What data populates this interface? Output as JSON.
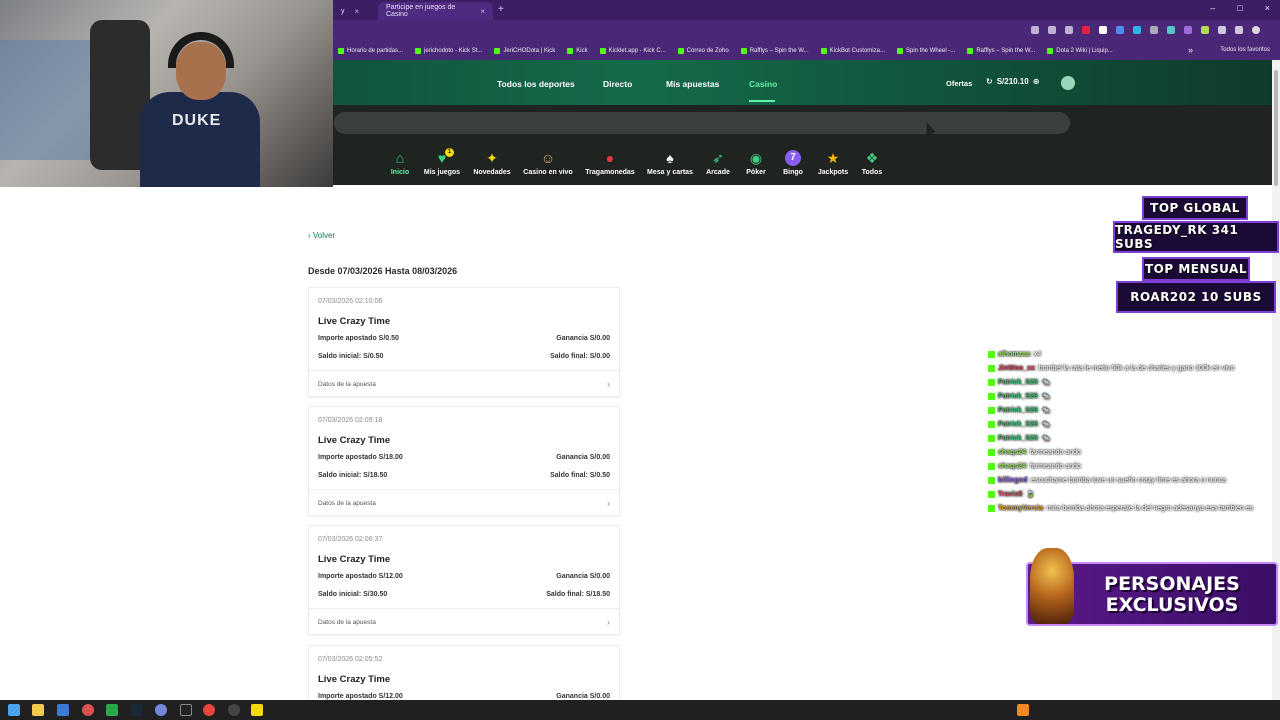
{
  "browser": {
    "tabs": [
      {
        "label": "y",
        "active": false
      },
      {
        "label": "Participe en juegos de Casino",
        "active": true
      }
    ],
    "bookmarks": [
      "Horario de partidas...",
      "jerichodoto - Kick St...",
      "JeriCHODota | Kick",
      "Kick",
      "Kicklet.app - Kick C...",
      "Correo de Zoho",
      "Rafflys – Spin the W...",
      "KickBot Customiza...",
      "Spin the Wheel -...",
      "Rafflys – Spin the W...",
      "Dota 2 Wiki | Liquip..."
    ],
    "bookmarks_more": "»",
    "all_bookmarks": "Todos los favoritos"
  },
  "site": {
    "nav": [
      "Todos los deportes",
      "Directo",
      "Mis apuestas",
      "Casino"
    ],
    "ofertas": "Ofertas",
    "balance": "S/210.10",
    "categories": [
      {
        "label": "Inicio",
        "icon": "home-icon",
        "glyph": "⌂"
      },
      {
        "label": "Mis juegos",
        "icon": "heart-icon",
        "glyph": "♥"
      },
      {
        "label": "Novedades",
        "icon": "sparkle-icon",
        "glyph": "✦"
      },
      {
        "label": "Casino en vivo",
        "icon": "dealer-icon",
        "glyph": "☺"
      },
      {
        "label": "Tragamonedas",
        "icon": "cherries-icon",
        "glyph": "●"
      },
      {
        "label": "Mesa y cartas",
        "icon": "cards-icon",
        "glyph": "♠"
      },
      {
        "label": "Arcade",
        "icon": "rocket-icon",
        "glyph": "➶"
      },
      {
        "label": "Póker",
        "icon": "chip-icon",
        "glyph": "◉"
      },
      {
        "label": "Bingo",
        "icon": "bingo-ball-icon",
        "glyph": "7"
      },
      {
        "label": "Jackpots",
        "icon": "star-icon",
        "glyph": "★"
      },
      {
        "label": "Todos",
        "icon": "grid-icon",
        "glyph": "❖"
      }
    ],
    "mis_juegos_badge": "1"
  },
  "content": {
    "volver": "Volver",
    "range": "Desde 07/03/2026 Hasta 08/03/2026",
    "bets": [
      {
        "date": "07/03/2026 02:10:06",
        "game": "Live Crazy Time",
        "importe": "Importe apostado S/0.50",
        "ganancia": "Ganancia S/0.00",
        "saldo_inicial": "Saldo inicial: S/0.50",
        "saldo_final": "Saldo final: S/0.00",
        "details": "Datos de la apuesta"
      },
      {
        "date": "07/03/2026 02:09:18",
        "game": "Live Crazy Time",
        "importe": "Importe apostado S/18.00",
        "ganancia": "Ganancia S/0.00",
        "saldo_inicial": "Saldo inicial: S/18.50",
        "saldo_final": "Saldo final: S/0.50",
        "details": "Datos de la apuesta"
      },
      {
        "date": "07/03/2026 02:06:37",
        "game": "Live Crazy Time",
        "importe": "Importe apostado S/12.00",
        "ganancia": "Ganancia S/0.00",
        "saldo_inicial": "Saldo inicial: S/30.50",
        "saldo_final": "Saldo final: S/18.50",
        "details": "Datos de la apuesta"
      },
      {
        "date": "07/03/2026 02:05:52",
        "game": "Live Crazy Time",
        "importe": "Importe apostado S/12.00",
        "ganancia": "Ganancia S/0.00",
        "saldo_inicial": "",
        "saldo_final": "",
        "details": ""
      }
    ]
  },
  "overlay": {
    "webcam_shirt": "DUKE",
    "top_global": "TOP GLOBAL",
    "top_global_user": "TRAGEDY_RK 341 SUBS",
    "top_mensual": "TOP MENSUAL",
    "top_mensual_user": "ROAR202 10 SUBS",
    "promo": "PERSONAJES EXCLUSIVOS",
    "chat": [
      {
        "user": "alhomzaa",
        "color": "#9be35f",
        "msg": ": x4"
      },
      {
        "user": "JinWoo_xx",
        "color": "#e0405a",
        "msg": ": bombel la rata le metio 50k a la de charles y gano 100k en vivo"
      },
      {
        "user": "Patrick_S26",
        "color": "#3fb86b",
        "msg": ": 🐀"
      },
      {
        "user": "Patrick_S26",
        "color": "#3fb86b",
        "msg": ": 🐀"
      },
      {
        "user": "Patrick_S26",
        "color": "#3fb86b",
        "msg": ": 🐀"
      },
      {
        "user": "Patrick_S26",
        "color": "#3fb86b",
        "msg": ": 🐀"
      },
      {
        "user": "Patrick_S26",
        "color": "#3fb86b",
        "msg": ": 🐀"
      },
      {
        "user": "shaqs24",
        "color": "#9be35f",
        "msg": ": farmeando ando"
      },
      {
        "user": "shaqs24",
        "color": "#9be35f",
        "msg": ": farmeando ando"
      },
      {
        "user": "billingod",
        "color": "#8a5cf6",
        "msg": ": escuchame bomba tuve un sueño crazy time es ahora o nunca"
      },
      {
        "user": "Travis8",
        "color": "#e0405a",
        "msg": ": 🍃"
      },
      {
        "user": "TommyVercia",
        "color": "#e89a2a",
        "msg": ": mira bomba ahora esperate la del negro adesanya esa tambien es"
      }
    ]
  }
}
